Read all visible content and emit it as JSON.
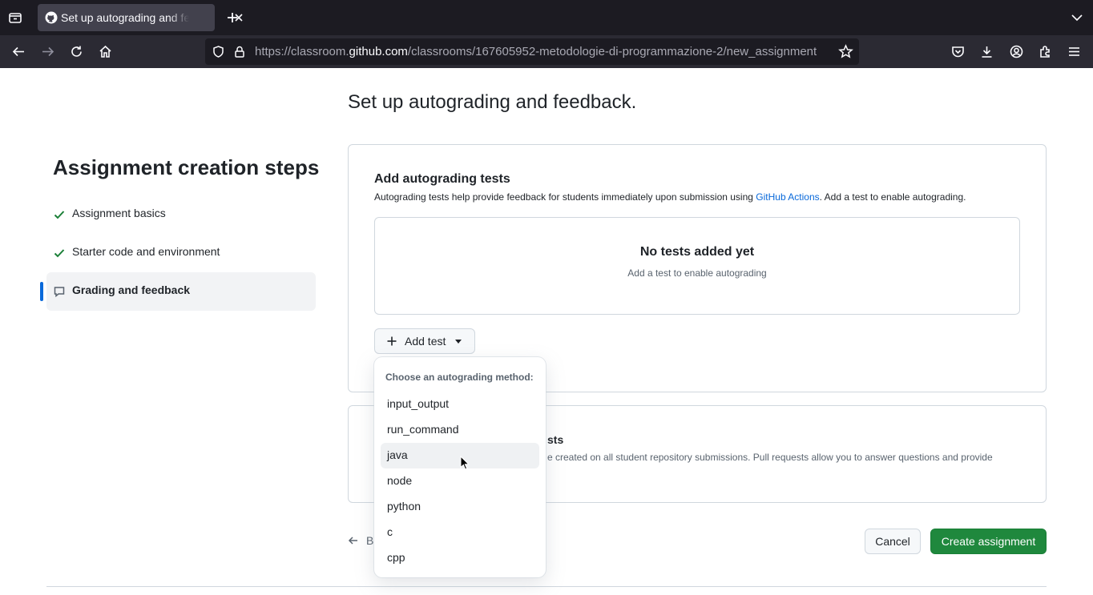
{
  "browser": {
    "tab_title": "Set up autograding and feedback",
    "url_prefix": "https://classroom.",
    "url_host": "github.com",
    "url_path": "/classrooms/167605952-metodologie-di-programmazione-2/new_assignment"
  },
  "page": {
    "title": "Set up autograding and feedback."
  },
  "sidebar": {
    "title": "Assignment creation steps",
    "steps": [
      {
        "label": "Assignment basics",
        "status": "done"
      },
      {
        "label": "Starter code and environment",
        "status": "done"
      },
      {
        "label": "Grading and feedback",
        "status": "active"
      }
    ]
  },
  "autograding": {
    "heading": "Add autograding tests",
    "description_before": "Autograding tests help provide feedback for students immediately upon submission using ",
    "description_link": "GitHub Actions",
    "description_after": ". Add a test to enable autograding.",
    "empty_title": "No tests added yet",
    "empty_subtitle": "Add a test to enable autograding",
    "add_test_label": "Add test"
  },
  "feedback": {
    "heading_visible": "sts",
    "description_visible": "e created on all student repository submissions. Pull requests allow you to answer questions and provide"
  },
  "dropdown": {
    "header": "Choose an autograding method:",
    "items": [
      "input_output",
      "run_command",
      "java",
      "node",
      "python",
      "c",
      "cpp"
    ],
    "hovered": "java"
  },
  "footer": {
    "back_label": "B",
    "cancel_label": "Cancel",
    "create_label": "Create assignment"
  },
  "colors": {
    "accent": "#0969da",
    "success": "#1f883d",
    "check": "#1a7f37"
  }
}
